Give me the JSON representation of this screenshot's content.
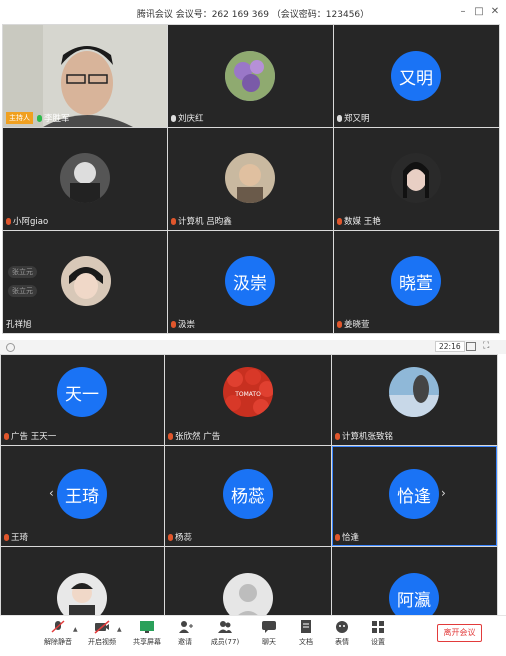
{
  "window": {
    "title": "腾讯会议  会议号：262 169 369 （会议密码：123456）"
  },
  "top_tiles": [
    {
      "name": "李胜军",
      "host": "主持人",
      "kind": "video"
    },
    {
      "name": "刘庆红",
      "kind": "photo"
    },
    {
      "name": "郑又明",
      "avatar_text": "又明",
      "kind": "text"
    },
    {
      "name": "小阿giao",
      "kind": "photo"
    },
    {
      "name": "计算机 吕昀鑫",
      "kind": "photo"
    },
    {
      "name": "数媒 王艳",
      "kind": "photo"
    },
    {
      "name": "孔祥旭",
      "kind": "photo",
      "chips": [
        "张立元",
        "张立元"
      ]
    },
    {
      "name": "汲崇",
      "avatar_text": "汲崇",
      "kind": "text"
    },
    {
      "name": "姜晓萱",
      "avatar_text": "晓萱",
      "kind": "text"
    }
  ],
  "second_window": {
    "time": "22:16"
  },
  "bottom_tiles": [
    {
      "name": "广告 王天一",
      "avatar_text": "天一",
      "kind": "text"
    },
    {
      "name": "张欣然 广告",
      "kind": "photo",
      "photo_text": "TOMATO"
    },
    {
      "name": "计算机张致铭",
      "kind": "photo"
    },
    {
      "name": "王琦",
      "avatar_text": "王琦",
      "kind": "text"
    },
    {
      "name": "杨蕊",
      "avatar_text": "杨蕊",
      "kind": "text"
    },
    {
      "name": "恰逢",
      "avatar_text": "恰逢",
      "kind": "text"
    },
    {
      "name": "",
      "kind": "photo"
    },
    {
      "name": "",
      "kind": "placeholder"
    },
    {
      "name": "",
      "avatar_text": "阿瀛",
      "kind": "text"
    }
  ],
  "toolbar": {
    "items": [
      {
        "label": "解除静音",
        "icon": "mic-muted-icon"
      },
      {
        "label": "开启视频",
        "icon": "camera-off-icon"
      },
      {
        "label": "共享屏幕",
        "icon": "screen-share-icon"
      },
      {
        "label": "邀请",
        "icon": "invite-icon"
      },
      {
        "label": "成员(77)",
        "icon": "members-icon"
      },
      {
        "label": "聊天",
        "icon": "chat-icon"
      },
      {
        "label": "文档",
        "icon": "document-icon"
      },
      {
        "label": "表情",
        "icon": "emoji-icon"
      },
      {
        "label": "设置",
        "icon": "settings-icon"
      }
    ],
    "leave_label": "离开会议"
  },
  "colors": {
    "avatar_blue": "#1a73f5",
    "tile_bg": "#262626",
    "leave_red": "#e23b3b"
  }
}
